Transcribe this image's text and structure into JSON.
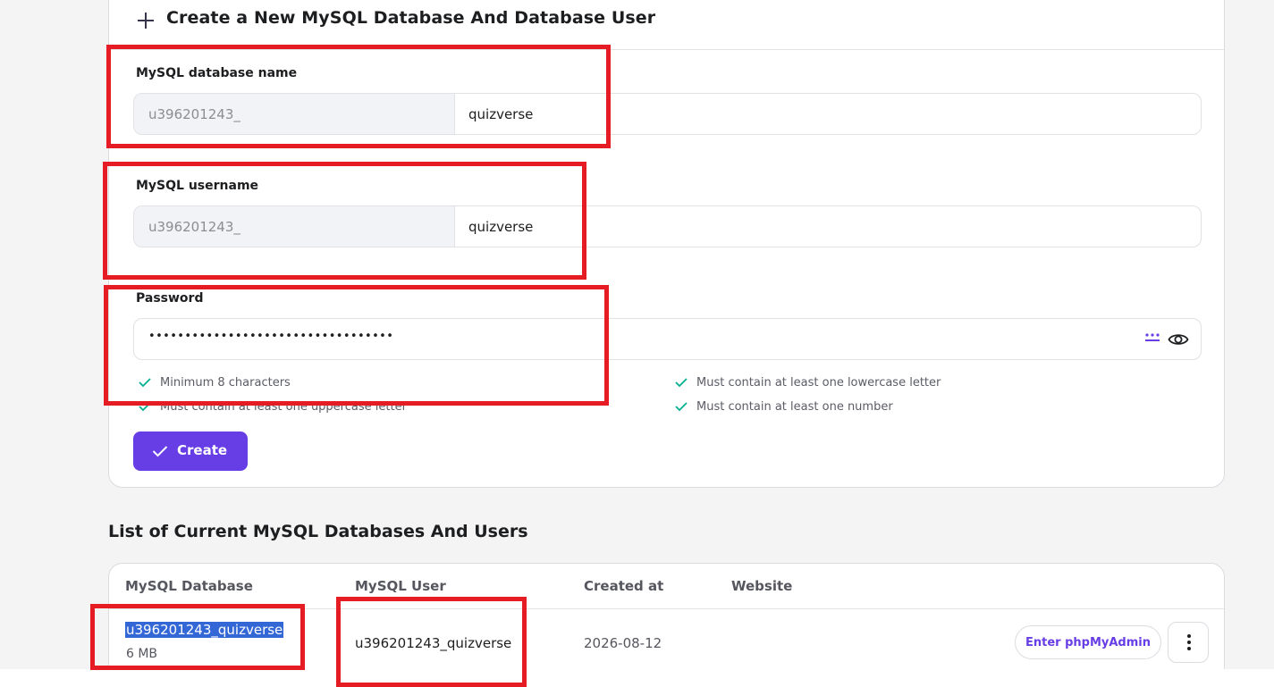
{
  "form": {
    "title": "Create a New MySQL Database And Database User",
    "db_name_label": "MySQL database name",
    "db_prefix": "u396201243_",
    "db_name_value": "quizverse",
    "username_label": "MySQL username",
    "user_prefix": "u396201243_",
    "username_value": "quizverse",
    "password_label": "Password",
    "password_mask": "••••••••••••••••••••••••••••••••••",
    "requirements": [
      "Minimum 8 characters",
      "Must contain at least one uppercase letter",
      "Must contain at least one lowercase letter",
      "Must contain at least one number"
    ],
    "create_label": "Create"
  },
  "list": {
    "title": "List of Current MySQL Databases And Users",
    "columns": [
      "MySQL Database",
      "MySQL User",
      "Created at",
      "Website"
    ],
    "rows": [
      {
        "database": "u396201243_quizverse",
        "size": "6 MB",
        "user": "u396201243_quizverse",
        "created_at": "2026-08-12",
        "action_label": "Enter phpMyAdmin"
      }
    ]
  },
  "colors": {
    "accent": "#673de6",
    "annotation": "#e51c23",
    "check": "#00b090",
    "selection": "#3367d6"
  },
  "icons": [
    "plus-icon",
    "generate-password-icon",
    "eye-icon",
    "check-icon",
    "more-vertical-icon"
  ]
}
